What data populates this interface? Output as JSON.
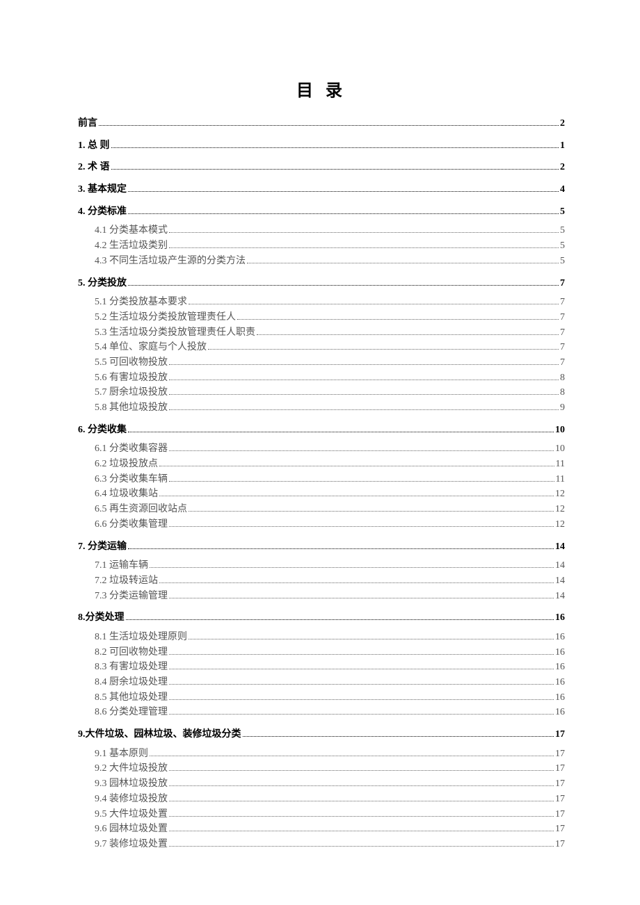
{
  "title": "目 录",
  "top_entries": [
    {
      "label": "前言",
      "page": "2"
    },
    {
      "label": "1.  总  则",
      "page": "1"
    },
    {
      "label": "2.  术  语",
      "page": "2"
    },
    {
      "label": "3.  基本规定",
      "page": "4"
    }
  ],
  "sections": [
    {
      "label": "4. 分类标准",
      "page": "5",
      "subs": [
        {
          "label": "4.1 分类基本模式",
          "page": "5"
        },
        {
          "label": "4.2 生活垃圾类别",
          "page": "5"
        },
        {
          "label": "4.3 不同生活垃圾产生源的分类方法",
          "page": "5"
        }
      ]
    },
    {
      "label": "5. 分类投放",
      "page": "7",
      "subs": [
        {
          "label": "5.1 分类投放基本要求",
          "page": "7"
        },
        {
          "label": "5.2 生活垃圾分类投放管理责任人",
          "page": "7"
        },
        {
          "label": "5.3 生活垃圾分类投放管理责任人职责",
          "page": "7"
        },
        {
          "label": "5.4 单位、家庭与个人投放",
          "page": "7"
        },
        {
          "label": "5.5 可回收物投放",
          "page": "7"
        },
        {
          "label": "5.6 有害垃圾投放",
          "page": "8"
        },
        {
          "label": "5.7 厨余垃圾投放",
          "page": "8"
        },
        {
          "label": "5.8 其他垃圾投放",
          "page": "9"
        }
      ]
    },
    {
      "label": "6.  分类收集",
      "page": "10",
      "subs": [
        {
          "label": "6.1 分类收集容器",
          "page": "10"
        },
        {
          "label": "6.2 垃圾投放点",
          "page": "11"
        },
        {
          "label": "6.3 分类收集车辆",
          "page": "11"
        },
        {
          "label": "6.4 垃圾收集站",
          "page": "12"
        },
        {
          "label": "6.5 再生资源回收站点",
          "page": "12"
        },
        {
          "label": "6.6 分类收集管理",
          "page": "12"
        }
      ]
    },
    {
      "label": "7.  分类运输",
      "page": "14",
      "subs": [
        {
          "label": "7.1 运输车辆",
          "page": "14"
        },
        {
          "label": "7.2 垃圾转运站",
          "page": "14"
        },
        {
          "label": "7.3 分类运输管理",
          "page": "14"
        }
      ]
    },
    {
      "label": "8.分类处理",
      "page": "16",
      "subs": [
        {
          "label": "8.1 生活垃圾处理原则",
          "page": "16"
        },
        {
          "label": "8.2 可回收物处理",
          "page": "16"
        },
        {
          "label": "8.3 有害垃圾处理",
          "page": "16"
        },
        {
          "label": "8.4 厨余垃圾处理",
          "page": "16"
        },
        {
          "label": "8.5 其他垃圾处理",
          "page": "16"
        },
        {
          "label": "8.6 分类处理管理",
          "page": "16"
        }
      ]
    },
    {
      "label": "9.大件垃圾、园林垃圾、装修垃圾分类",
      "page": "17",
      "subs": [
        {
          "label": "9.1 基本原则",
          "page": "17"
        },
        {
          "label": "9.2 大件垃圾投放",
          "page": "17"
        },
        {
          "label": "9.3 园林垃圾投放",
          "page": "17"
        },
        {
          "label": "9.4 装修垃圾投放",
          "page": "17"
        },
        {
          "label": "9.5 大件垃圾处置",
          "page": "17"
        },
        {
          "label": "9.6 园林垃圾处置",
          "page": "17"
        },
        {
          "label": "9.7 装修垃圾处置",
          "page": "17"
        }
      ]
    }
  ]
}
